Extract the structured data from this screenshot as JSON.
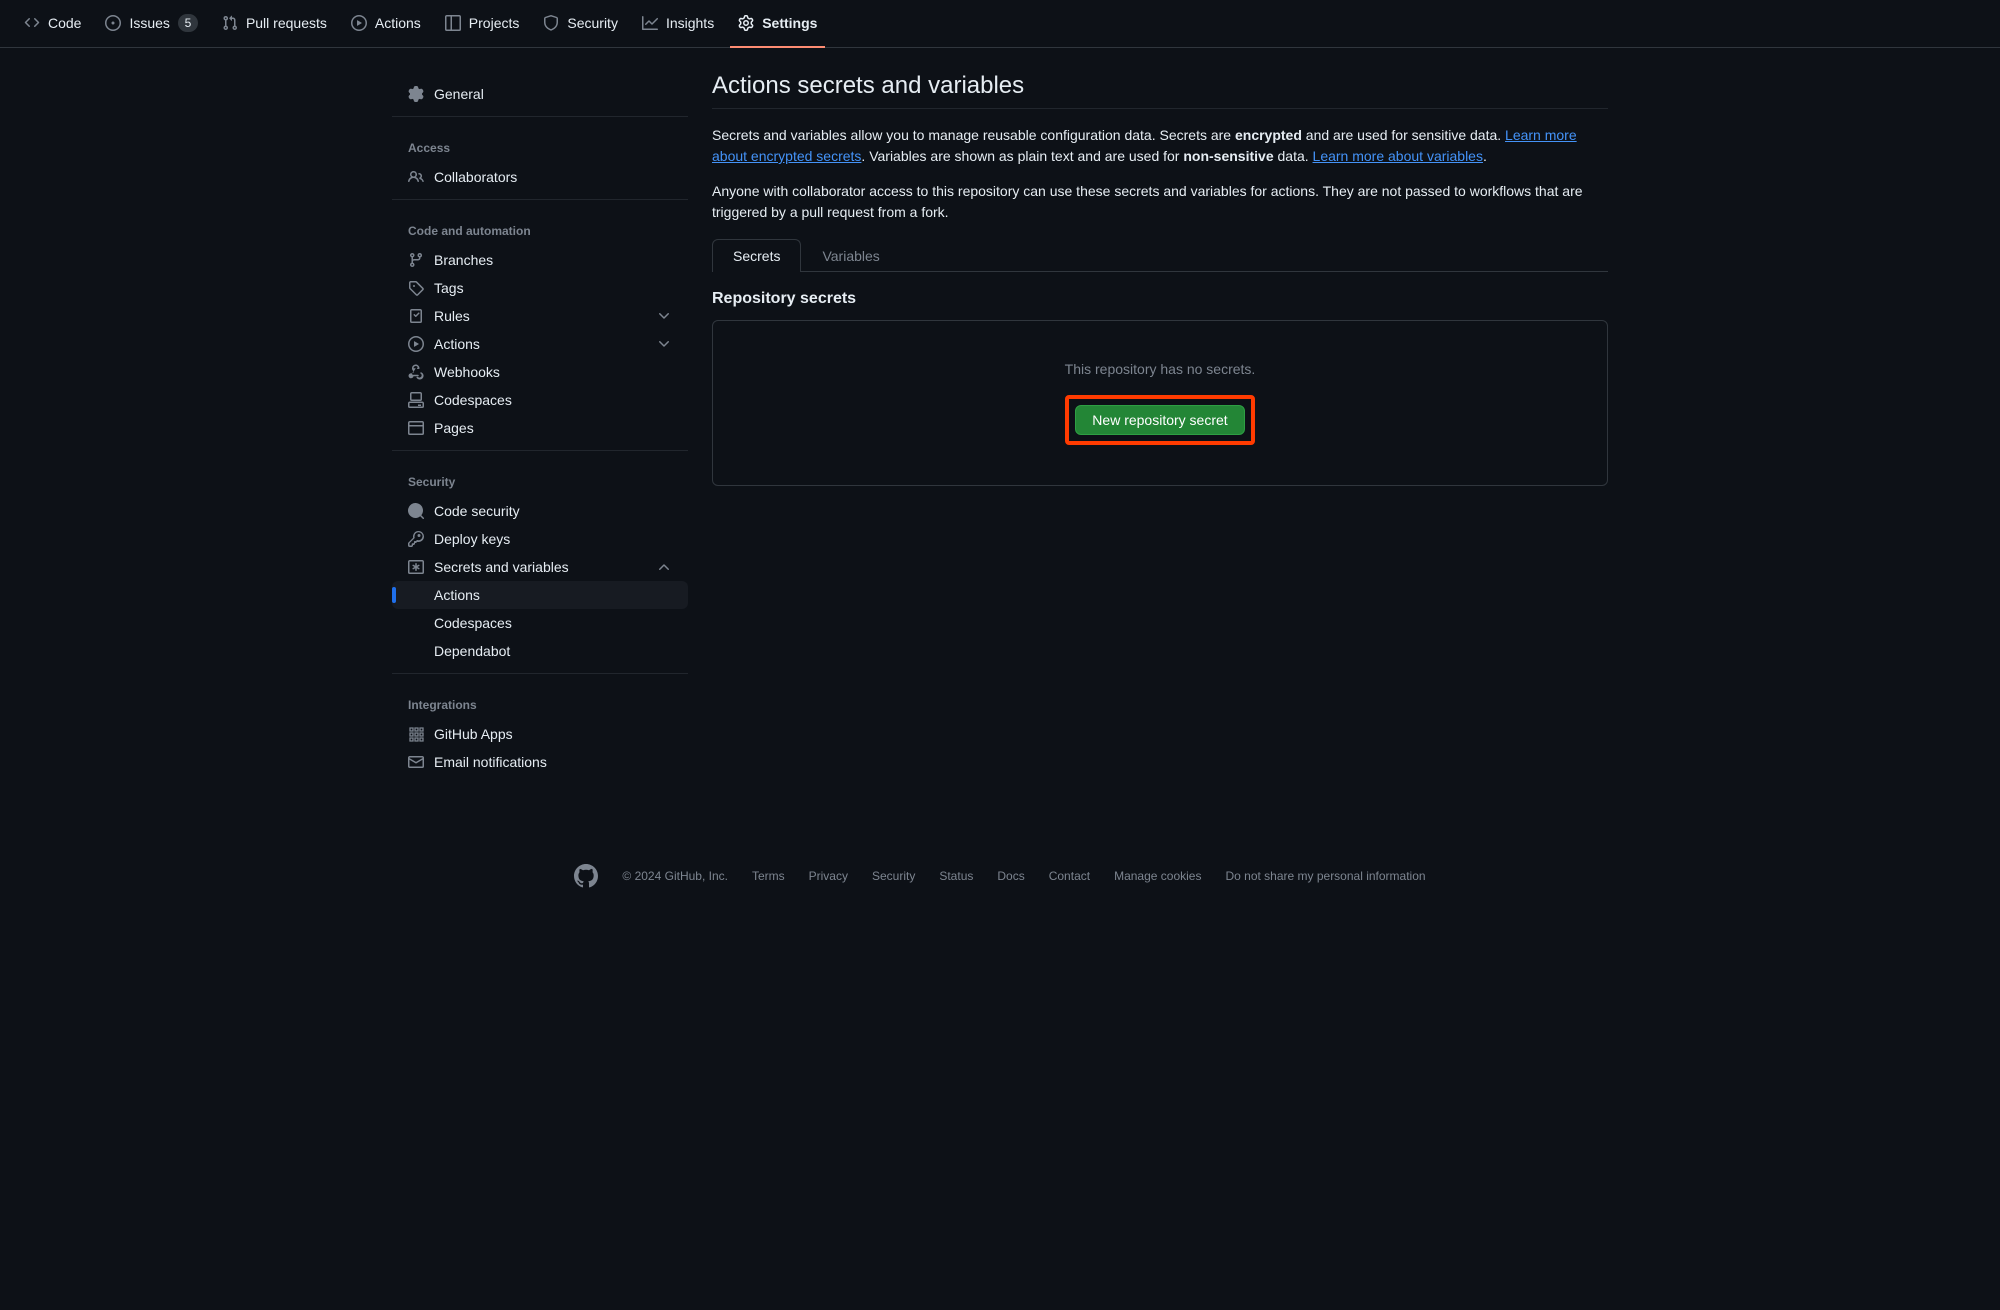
{
  "topnav": {
    "code": "Code",
    "issues": "Issues",
    "issues_count": "5",
    "pulls": "Pull requests",
    "actions": "Actions",
    "projects": "Projects",
    "security": "Security",
    "insights": "Insights",
    "settings": "Settings"
  },
  "sidebar": {
    "general": "General",
    "access_head": "Access",
    "collaborators": "Collaborators",
    "code_head": "Code and automation",
    "branches": "Branches",
    "tags": "Tags",
    "rules": "Rules",
    "actions": "Actions",
    "webhooks": "Webhooks",
    "codespaces": "Codespaces",
    "pages": "Pages",
    "security_head": "Security",
    "code_security": "Code security",
    "deploy_keys": "Deploy keys",
    "secrets_vars": "Secrets and variables",
    "sub_actions": "Actions",
    "sub_codespaces": "Codespaces",
    "sub_dependabot": "Dependabot",
    "integrations_head": "Integrations",
    "github_apps": "GitHub Apps",
    "email_notifications": "Email notifications"
  },
  "main": {
    "title": "Actions secrets and variables",
    "intro_seg1": "Secrets and variables allow you to manage reusable configuration data. Secrets are ",
    "intro_seg2": "encrypted",
    "intro_seg3": " and are used for sensitive data. ",
    "intro_link1": "Learn more about encrypted secrets",
    "intro_seg4": ". Variables are shown as plain text and are used for ",
    "intro_seg5": "non-sensitive",
    "intro_seg6": " data. ",
    "intro_link2": "Learn more about variables",
    "intro_seg7": ".",
    "intro_p2": "Anyone with collaborator access to this repository can use these secrets and variables for actions. They are not passed to workflows that are triggered by a pull request from a fork.",
    "tab_secrets": "Secrets",
    "tab_variables": "Variables",
    "section_title": "Repository secrets",
    "empty_msg": "This repository has no secrets.",
    "new_btn": "New repository secret"
  },
  "footer": {
    "copyright": "© 2024 GitHub, Inc.",
    "terms": "Terms",
    "privacy": "Privacy",
    "security": "Security",
    "status": "Status",
    "docs": "Docs",
    "contact": "Contact",
    "manage_cookies": "Manage cookies",
    "do_not_share": "Do not share my personal information"
  }
}
